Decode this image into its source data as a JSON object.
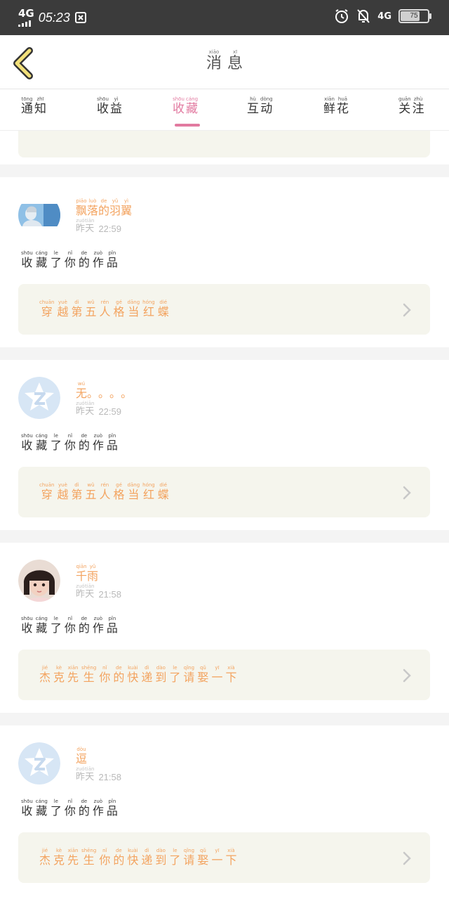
{
  "status_bar": {
    "network": "4G",
    "time": "05:23",
    "network_right": "4G",
    "battery": "75",
    "battery_level": 0.75
  },
  "header": {
    "title": [
      {
        "c": "消",
        "p": "xiāo"
      },
      {
        "c": "息",
        "p": "xī"
      }
    ]
  },
  "tabs": [
    {
      "chars": [
        {
          "c": "通",
          "p": "tōng"
        },
        {
          "c": "知",
          "p": "zhī"
        }
      ],
      "active": false
    },
    {
      "chars": [
        {
          "c": "收",
          "p": "shōu"
        },
        {
          "c": "益",
          "p": "yì"
        }
      ],
      "active": false
    },
    {
      "chars": [
        {
          "c": "收",
          "p": "shōu"
        },
        {
          "c": "藏",
          "p": "cáng"
        }
      ],
      "active": true
    },
    {
      "chars": [
        {
          "c": "互",
          "p": "hù"
        },
        {
          "c": "动",
          "p": "dòng"
        }
      ],
      "active": false
    },
    {
      "chars": [
        {
          "c": "鲜",
          "p": "xiān"
        },
        {
          "c": "花",
          "p": "huā"
        }
      ],
      "active": false
    },
    {
      "chars": [
        {
          "c": "关",
          "p": "guān"
        },
        {
          "c": "注",
          "p": "zhù"
        }
      ],
      "active": false
    }
  ],
  "partial_work": [
    {
      "c": "穿",
      "p": ""
    },
    {
      "c": "越",
      "p": ""
    },
    {
      "c": "第",
      "p": ""
    },
    {
      "c": "五",
      "p": ""
    },
    {
      "c": "人",
      "p": ""
    },
    {
      "c": "格",
      "p": ""
    },
    {
      "c": "当",
      "p": ""
    },
    {
      "c": "红",
      "p": ""
    },
    {
      "c": "蝶",
      "p": ""
    }
  ],
  "action_text": [
    {
      "c": "收",
      "p": "shōu"
    },
    {
      "c": "藏",
      "p": "cáng"
    },
    {
      "c": "了",
      "p": "le"
    },
    {
      "c": "你",
      "p": "nǐ"
    },
    {
      "c": "的",
      "p": "de"
    },
    {
      "c": "作",
      "p": "zuò"
    },
    {
      "c": "品",
      "p": "pǐn"
    }
  ],
  "yesterday": [
    {
      "c": "昨",
      "p": "zuó"
    },
    {
      "c": "天",
      "p": "tiān"
    }
  ],
  "items": [
    {
      "avatar": "photo-avatar",
      "name": [
        {
          "c": "飘",
          "p": "piāo"
        },
        {
          "c": "落",
          "p": "luò"
        },
        {
          "c": "的",
          "p": "de"
        },
        {
          "c": "羽",
          "p": "yǔ"
        },
        {
          "c": "翼",
          "p": "yì"
        }
      ],
      "time": "22:59",
      "work": [
        {
          "c": "穿",
          "p": "chuān"
        },
        {
          "c": "越",
          "p": "yuè"
        },
        {
          "c": "第",
          "p": "dì"
        },
        {
          "c": "五",
          "p": "wǔ"
        },
        {
          "c": "人",
          "p": "rén"
        },
        {
          "c": "格",
          "p": "gé"
        },
        {
          "c": "当",
          "p": "dāng"
        },
        {
          "c": "红",
          "p": "hóng"
        },
        {
          "c": "蝶",
          "p": "dié"
        }
      ]
    },
    {
      "avatar": "default-avatar",
      "name": [
        {
          "c": "无",
          "p": "wú"
        },
        {
          "c": "。",
          "p": ""
        },
        {
          "c": "。",
          "p": ""
        },
        {
          "c": "。",
          "p": ""
        },
        {
          "c": "。",
          "p": ""
        }
      ],
      "time": "22:59",
      "work": [
        {
          "c": "穿",
          "p": "chuān"
        },
        {
          "c": "越",
          "p": "yuè"
        },
        {
          "c": "第",
          "p": "dì"
        },
        {
          "c": "五",
          "p": "wǔ"
        },
        {
          "c": "人",
          "p": "rén"
        },
        {
          "c": "格",
          "p": "gé"
        },
        {
          "c": "当",
          "p": "dāng"
        },
        {
          "c": "红",
          "p": "hóng"
        },
        {
          "c": "蝶",
          "p": "dié"
        }
      ]
    },
    {
      "avatar": "girl-avatar",
      "name": [
        {
          "c": "千",
          "p": "qiān"
        },
        {
          "c": "雨",
          "p": "yǔ"
        }
      ],
      "time": "21:58",
      "work": [
        {
          "c": "杰",
          "p": "jié"
        },
        {
          "c": "克",
          "p": "kè"
        },
        {
          "c": "先",
          "p": "xiān"
        },
        {
          "c": "生",
          "p": "shēng"
        },
        {
          "c": "你",
          "p": "nǐ"
        },
        {
          "c": "的",
          "p": "de"
        },
        {
          "c": "快",
          "p": "kuài"
        },
        {
          "c": "递",
          "p": "dì"
        },
        {
          "c": "到",
          "p": "dào"
        },
        {
          "c": "了",
          "p": "le"
        },
        {
          "c": "请",
          "p": "qǐng"
        },
        {
          "c": "娶",
          "p": "qǔ"
        },
        {
          "c": "一",
          "p": "yī"
        },
        {
          "c": "下",
          "p": "xià"
        }
      ]
    },
    {
      "avatar": "default-avatar",
      "name": [
        {
          "c": "逗",
          "p": "dòu"
        }
      ],
      "time": "21:58",
      "work": [
        {
          "c": "杰",
          "p": "jié"
        },
        {
          "c": "克",
          "p": "kè"
        },
        {
          "c": "先",
          "p": "xiān"
        },
        {
          "c": "生",
          "p": "shēng"
        },
        {
          "c": "你",
          "p": "nǐ"
        },
        {
          "c": "的",
          "p": "de"
        },
        {
          "c": "快",
          "p": "kuài"
        },
        {
          "c": "递",
          "p": "dì"
        },
        {
          "c": "到",
          "p": "dào"
        },
        {
          "c": "了",
          "p": "le"
        },
        {
          "c": "请",
          "p": "qǐng"
        },
        {
          "c": "娶",
          "p": "qǔ"
        },
        {
          "c": "一",
          "p": "yī"
        },
        {
          "c": "下",
          "p": "xià"
        }
      ]
    }
  ],
  "colors": {
    "accent_pink": "#e27aa0",
    "orange_text": "#f3a35f",
    "work_bg": "#f5f5ed",
    "status_bg": "#3b3b3b"
  }
}
